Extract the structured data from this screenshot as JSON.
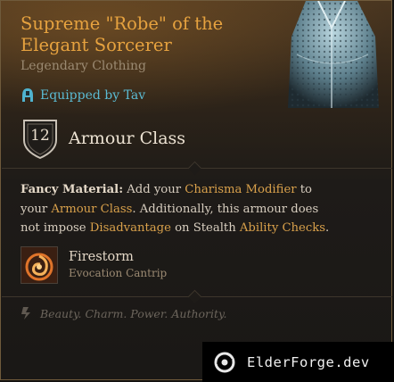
{
  "item": {
    "title_line1": "Supreme \"Robe\" of the",
    "title_line2": "Elegant Sorcerer",
    "rarity_type": "Legendary Clothing",
    "equipped_text": "Equipped by Tav",
    "armour_class_value": "12",
    "armour_class_label": "Armour Class"
  },
  "description": {
    "bold_label": "Fancy Material:",
    "p1": " Add your ",
    "k1": "Charisma",
    "p2": " ",
    "k2": "Modifier",
    "p3": " to your ",
    "k3": "Armour Class",
    "p4": ". Additionally, this armour does not impose ",
    "k4": "Disadvantage",
    "p5": " on Stealth ",
    "k5": "Ability Checks",
    "p6": "."
  },
  "spell": {
    "name": "Firestorm",
    "school": "Evocation Cantrip",
    "icon": "fire-spiral-icon"
  },
  "flavor_text": "Beauty. Charm. Power. Authority.",
  "watermark": {
    "text": "ElderForge.dev",
    "icon": "elderforge-logo-icon"
  },
  "colors": {
    "title": "#e6a23f",
    "keyword": "#d8a04b",
    "equipped": "#5bbbd3",
    "panel_border": "#6f5a3b"
  }
}
